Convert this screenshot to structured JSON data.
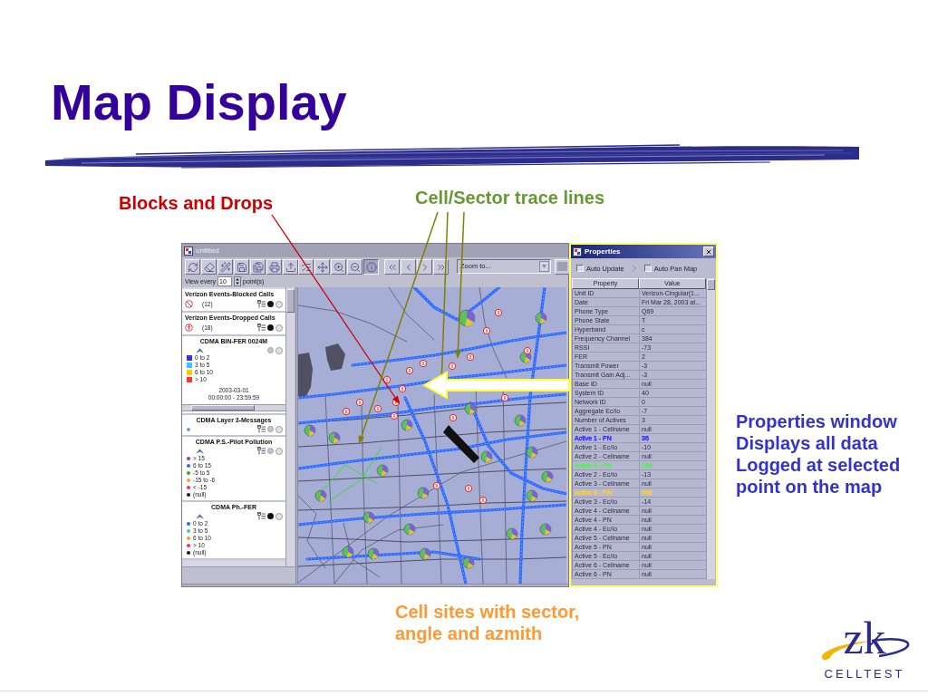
{
  "title": "Map Display",
  "callouts": {
    "blocks": {
      "text": "Blocks and Drops"
    },
    "traces": {
      "text": "Cell/Sector trace lines"
    },
    "properties": {
      "lines": [
        "Properties window",
        "Displays all data",
        "Logged at selected",
        "point on the map"
      ]
    },
    "cell_sites": {
      "lines": [
        "Cell sites with sector,",
        "angle and azmith"
      ]
    }
  },
  "map_window": {
    "title": "untitled",
    "active": false,
    "file_tools": [
      {
        "kind": "refresh"
      },
      {
        "kind": "eraser"
      },
      {
        "kind": "wand"
      },
      {
        "kind": "save"
      },
      {
        "kind": "saveas"
      },
      {
        "kind": "print"
      },
      {
        "kind": "export"
      }
    ],
    "map_tools": [
      {
        "kind": "layers",
        "selected": false
      },
      {
        "kind": "pan",
        "selected": false
      },
      {
        "kind": "zoomin",
        "selected": false
      },
      {
        "kind": "zoomout",
        "selected": false
      },
      {
        "kind": "info",
        "selected": true
      }
    ],
    "nav_tools": [
      {
        "kind": "first"
      },
      {
        "kind": "prev"
      },
      {
        "kind": "next"
      },
      {
        "kind": "last"
      }
    ],
    "view_every": {
      "label": "View every",
      "value": "10",
      "unit": "point(s)"
    },
    "zoom": {
      "value": "Zoom to..."
    },
    "legend": [
      {
        "kind": "blocked",
        "title": "Verizon Events-Blocked Calls",
        "count": "(12)",
        "visible": true
      },
      {
        "kind": "dropped",
        "title": "Verizon Events-Dropped Calls",
        "count": "(18)",
        "visible": true
      },
      {
        "kind": "grid",
        "title": "CDMA BIN-FER 0024M",
        "expanded": true,
        "visible": false,
        "entries": [
          {
            "label": "0 to 2",
            "color": "#3333ee"
          },
          {
            "label": "3 to 5",
            "color": "#33ccff"
          },
          {
            "label": "6 to 10",
            "color": "#ffcc00"
          },
          {
            "label": "> 10",
            "color": "#ff3333"
          }
        ],
        "date": "2003-03-01",
        "time_range": "00:00:00 - 23:59:59"
      },
      {
        "kind": "points",
        "title": "CDMA Layer 3-Messages",
        "visible": false,
        "entries": [
          {
            "color": "#6699ff"
          }
        ]
      },
      {
        "kind": "points",
        "title": "CDMA P.S.-Pilot Pollution",
        "expanded": true,
        "visible": false,
        "entries": [
          {
            "label": "> 15",
            "color": "#9933cc"
          },
          {
            "label": "6 to 15",
            "color": "#3366ee"
          },
          {
            "label": "-5 to 5",
            "color": "#33aa33"
          },
          {
            "label": "-15 to -6",
            "color": "#ff9933"
          },
          {
            "label": "< -15",
            "color": "#ee3366"
          },
          {
            "label": "(null)",
            "color": "#111111"
          }
        ]
      },
      {
        "kind": "points",
        "title": "CDMA Ph.-FER",
        "expanded": true,
        "visible": true,
        "entries": [
          {
            "label": "0 to 2",
            "color": "#3366ee"
          },
          {
            "label": "3 to 5",
            "color": "#33cccc"
          },
          {
            "label": "6 to 10",
            "color": "#ff9933"
          },
          {
            "label": "> 10",
            "color": "#ee3366"
          },
          {
            "label": "(null)",
            "color": "#111111"
          }
        ]
      }
    ]
  },
  "properties_window": {
    "title": "Properties",
    "active": true,
    "auto_update": {
      "label": "Auto Update",
      "checked": false
    },
    "auto_pan": {
      "label": "Auto Pan Map",
      "checked": false
    },
    "columns": [
      "Property",
      "Value"
    ],
    "rows": [
      {
        "property": "Unit ID",
        "value": "Verizon-Cingular(1..."
      },
      {
        "property": "Date",
        "value": "Fri Mar 28, 2003 at..."
      },
      {
        "property": "Phone Type",
        "value": "Q69"
      },
      {
        "property": "Phone State",
        "value": "T"
      },
      {
        "property": "Hyperband",
        "value": "c"
      },
      {
        "property": "Frequency Channel",
        "value": "384"
      },
      {
        "property": "RSSI",
        "value": "-73"
      },
      {
        "property": "FER",
        "value": "2"
      },
      {
        "property": "Transmit Power",
        "value": "-3"
      },
      {
        "property": "Transmit Gain Adj...",
        "value": "-3"
      },
      {
        "property": "Base ID",
        "value": "null"
      },
      {
        "property": "System ID",
        "value": "40"
      },
      {
        "property": "Network ID",
        "value": "0"
      },
      {
        "property": "Aggregate Ec/Io",
        "value": "-7"
      },
      {
        "property": "Number of Actives",
        "value": "3"
      },
      {
        "property": "Active 1 - Cellname",
        "value": "null"
      },
      {
        "property": "Active 1 - PN",
        "value": "36",
        "color": "#3333ff"
      },
      {
        "property": "Active 1 - Ec/Io",
        "value": "-10"
      },
      {
        "property": "Active 2 - Cellname",
        "value": "null"
      },
      {
        "property": "Active 2 - PN",
        "value": "208",
        "color": "#55ee55"
      },
      {
        "property": "Active 2 - Ec/Io",
        "value": "-13"
      },
      {
        "property": "Active 3 - Cellname",
        "value": "null"
      },
      {
        "property": "Active 3 - PN",
        "value": "360",
        "color": "#ffcc33"
      },
      {
        "property": "Active 3 - Ec/Io",
        "value": "-14"
      },
      {
        "property": "Active 4 - Cellname",
        "value": "null"
      },
      {
        "property": "Active 4 - PN",
        "value": "null"
      },
      {
        "property": "Active 4 - Ec/Io",
        "value": "null"
      },
      {
        "property": "Active 5 - Cellname",
        "value": "null"
      },
      {
        "property": "Active 5 - PN",
        "value": "null"
      },
      {
        "property": "Active 5 - Ec/Io",
        "value": "null"
      },
      {
        "property": "Active 6 - Cellname",
        "value": "null"
      },
      {
        "property": "Active 6 - PN",
        "value": "null"
      }
    ]
  },
  "logo": {
    "monogram": "zk",
    "wordmark": "CELLTEST"
  }
}
